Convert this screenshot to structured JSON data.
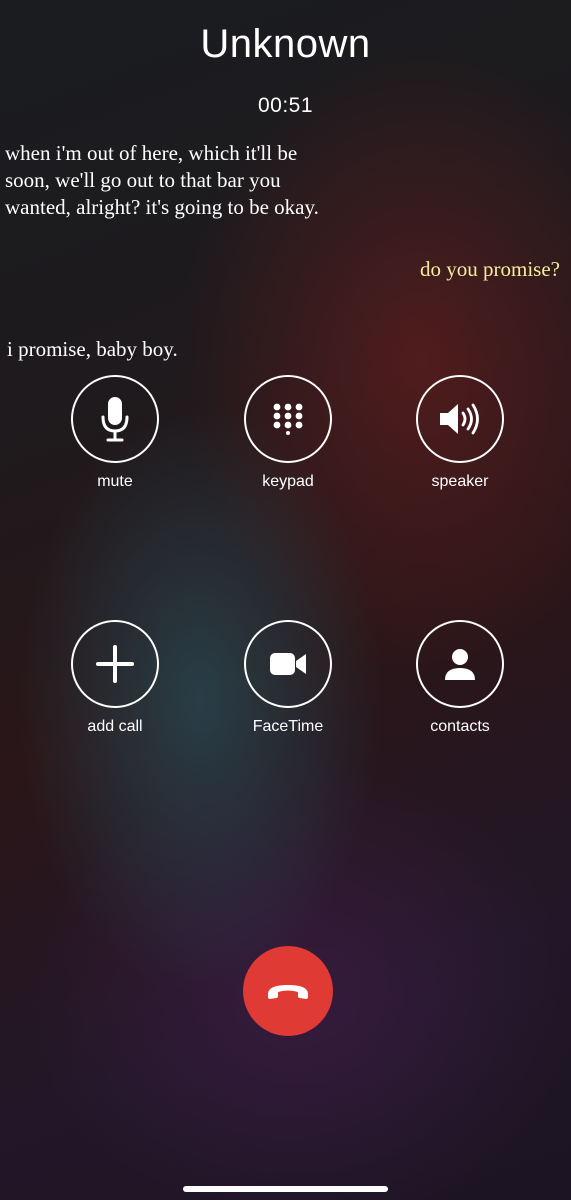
{
  "call": {
    "caller_name": "Unknown",
    "timer": "00:51"
  },
  "subtitles": [
    {
      "text": "when i'm out of here, which it'll be soon, we'll go out to that bar you wanted, alright? it's going to be okay.",
      "color": "#ffffff"
    },
    {
      "text": "do you promise?",
      "color": "#f4ee9c"
    },
    {
      "text": "i promise, baby boy.",
      "color": "#ffffff"
    }
  ],
  "controls": [
    {
      "label": "mute",
      "icon": "microphone-icon"
    },
    {
      "label": "keypad",
      "icon": "keypad-icon"
    },
    {
      "label": "speaker",
      "icon": "speaker-icon"
    },
    {
      "label": "add call",
      "icon": "plus-icon"
    },
    {
      "label": "FaceTime",
      "icon": "video-camera-icon"
    },
    {
      "label": "contacts",
      "icon": "person-icon"
    }
  ],
  "end_call": {
    "icon": "hang-up-icon",
    "color": "#df3a33"
  }
}
